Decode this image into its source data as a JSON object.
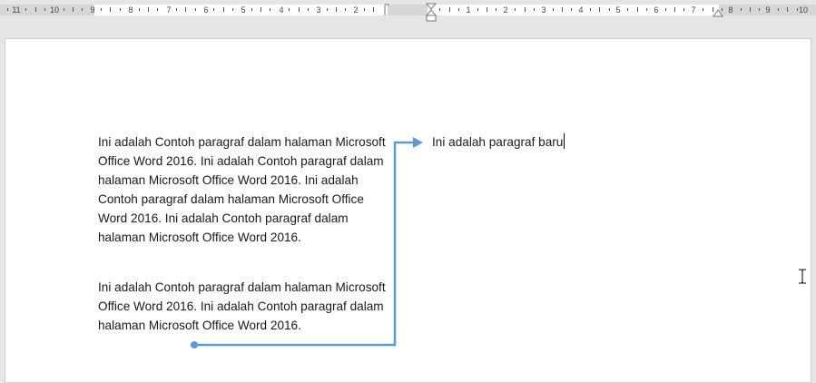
{
  "ruler": {
    "left_numbers": [
      "11",
      "10",
      "9",
      "8",
      "7",
      "6",
      "5",
      "4",
      "3",
      "2"
    ],
    "right_numbers": [
      "1",
      "2",
      "3",
      "4",
      "5",
      "6",
      "7",
      "8",
      "9",
      "10"
    ]
  },
  "document": {
    "paragraph_1": "Ini adalah Contoh paragraf dalam halaman Microsoft Office Word 2016. Ini adalah Contoh paragraf dalam halaman Microsoft Office Word 2016. Ini adalah Contoh paragraf dalam halaman Microsoft Office Word 2016. Ini adalah Contoh paragraf dalam halaman Microsoft Office Word 2016.",
    "paragraph_2": "Ini adalah Contoh paragraf dalam halaman Microsoft Office Word 2016. Ini adalah Contoh paragraf dalam halaman Microsoft Office Word 2016.",
    "new_paragraph": "Ini adalah paragraf baru"
  },
  "colors": {
    "arrow": "#5b9bd5",
    "page": "#ffffff",
    "background": "#e6e6e6"
  },
  "icons": {
    "cursor": "i-beam-cursor-icon",
    "arrow": "arrow-right-icon"
  }
}
